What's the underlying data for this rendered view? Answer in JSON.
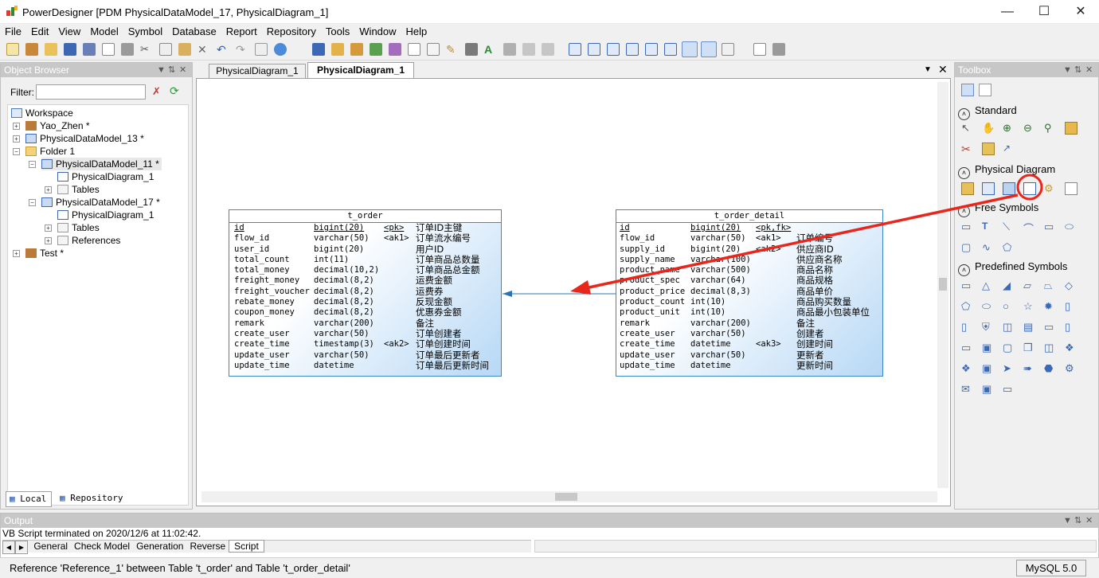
{
  "window": {
    "title": "PowerDesigner [PDM PhysicalDataModel_17, PhysicalDiagram_1]"
  },
  "menu": [
    "File",
    "Edit",
    "View",
    "Model",
    "Symbol",
    "Database",
    "Report",
    "Repository",
    "Tools",
    "Window",
    "Help"
  ],
  "object_browser": {
    "title": "Object Browser",
    "filter_label": "Filter:",
    "tree": [
      {
        "label": "Workspace",
        "level": 0
      },
      {
        "label": "Yao_Zhen *",
        "level": 1
      },
      {
        "label": "PhysicalDataModel_13 *",
        "level": 1
      },
      {
        "label": "Folder 1",
        "level": 1
      },
      {
        "label": "PhysicalDataModel_11 *",
        "level": 2
      },
      {
        "label": "PhysicalDiagram_1",
        "level": 3
      },
      {
        "label": "Tables",
        "level": 3
      },
      {
        "label": "PhysicalDataModel_17 *",
        "level": 2
      },
      {
        "label": "PhysicalDiagram_1",
        "level": 3
      },
      {
        "label": "Tables",
        "level": 3
      },
      {
        "label": "References",
        "level": 3
      },
      {
        "label": "Test *",
        "level": 1
      }
    ],
    "tabs": [
      "Local",
      "Repository"
    ]
  },
  "doc_tabs": [
    "PhysicalDiagram_1",
    "PhysicalDiagram_1"
  ],
  "tables": [
    {
      "name": "t_order",
      "rows": [
        [
          "id",
          "bigint(20)",
          "<pk>",
          "订单ID主键"
        ],
        [
          "flow_id",
          "varchar(50)",
          "<ak1>",
          "订单流水编号"
        ],
        [
          "user_id",
          "bigint(20)",
          "",
          "用户ID"
        ],
        [
          "total_count",
          "int(11)",
          "",
          "订单商品总数量"
        ],
        [
          "total_money",
          "decimal(10,2)",
          "",
          "订单商品总金额"
        ],
        [
          "freight_money",
          "decimal(8,2)",
          "",
          "运费金额"
        ],
        [
          "freight_voucher",
          "decimal(8,2)",
          "",
          "运费券"
        ],
        [
          "rebate_money",
          "decimal(8,2)",
          "",
          "反现金额"
        ],
        [
          "coupon_money",
          "decimal(8,2)",
          "",
          "优惠券金额"
        ],
        [
          "remark",
          "varchar(200)",
          "",
          "备注"
        ],
        [
          "create_user",
          "varchar(50)",
          "",
          "订单创建者"
        ],
        [
          "create_time",
          "timestamp(3)",
          "<ak2>",
          "订单创建时间"
        ],
        [
          "update_user",
          "varchar(50)",
          "",
          "订单最后更新者"
        ],
        [
          "update_time",
          "datetime",
          "",
          "订单最后更新时间"
        ]
      ]
    },
    {
      "name": "t_order_detail",
      "rows": [
        [
          "id",
          "bigint(20)",
          "<pk,fk>",
          ""
        ],
        [
          "flow_id",
          "varchar(50)",
          "<ak1>",
          "订单编号"
        ],
        [
          "supply_id",
          "bigint(20)",
          "<ak2>",
          "供应商ID"
        ],
        [
          "supply_name",
          "varchar(100)",
          "",
          "供应商名称"
        ],
        [
          "product_name",
          "varchar(500)",
          "",
          "商品名称"
        ],
        [
          "product_spec",
          "varchar(64)",
          "",
          "商品规格"
        ],
        [
          "product_price",
          "decimal(8,3)",
          "",
          "商品单价"
        ],
        [
          "product_count",
          "int(10)",
          "",
          "商品购买数量"
        ],
        [
          "product_unit",
          "int(10)",
          "",
          "商品最小包装单位"
        ],
        [
          "remark",
          "varchar(200)",
          "",
          "备注"
        ],
        [
          "create_user",
          "varchar(50)",
          "",
          "创建者"
        ],
        [
          "create_time",
          "datetime",
          "<ak3>",
          "创建时间"
        ],
        [
          "update_user",
          "varchar(50)",
          "",
          "更新者"
        ],
        [
          "update_time",
          "datetime",
          "",
          "更新时间"
        ]
      ]
    }
  ],
  "toolbox": {
    "title": "Toolbox",
    "groups": [
      "Standard",
      "Physical Diagram",
      "Free Symbols",
      "Predefined Symbols"
    ]
  },
  "output": {
    "title": "Output",
    "message": "VB Script terminated on 2020/12/6 at 11:02:42.",
    "tabs": [
      "General",
      "Check Model",
      "Generation",
      "Reverse",
      "Script"
    ]
  },
  "status": {
    "message": "Reference 'Reference_1' between Table 't_order' and Table 't_order_detail'",
    "dbms": "MySQL 5.0"
  },
  "colors": {
    "table_border": "#3b88c4",
    "table_gradient": "#b7d8f5",
    "annotation": "#e8261c"
  }
}
